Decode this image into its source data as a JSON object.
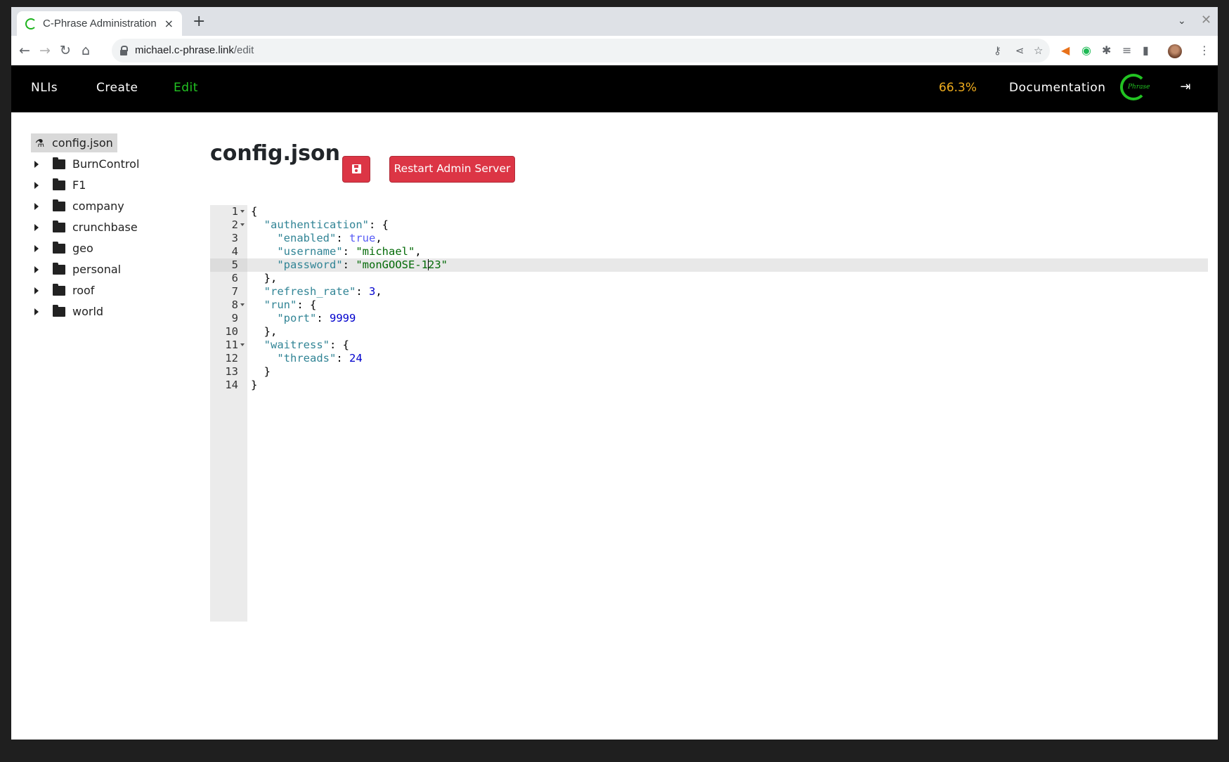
{
  "browser": {
    "tab_title": "C-Phrase Administration",
    "url_host": "michael.c-phrase.link",
    "url_path": "/edit",
    "new_tab_label": "+",
    "tab_close_label": "×"
  },
  "header": {
    "nav": [
      {
        "label": "NLIs"
      },
      {
        "label": "Create"
      },
      {
        "label": "Edit",
        "active": true
      }
    ],
    "usage": "66.3%",
    "documentation": "Documentation",
    "logo_text": "Phrase",
    "accent_color": "#22c322",
    "usage_color": "#f0ad1e"
  },
  "tree": {
    "selected_file": "config.json",
    "folders": [
      "BurnControl",
      "F1",
      "company",
      "crunchbase",
      "geo",
      "personal",
      "roof",
      "world"
    ]
  },
  "main": {
    "title": "config.json",
    "restart_label": "Restart Admin Server",
    "button_color": "#dc3545"
  },
  "editor": {
    "active_line": 5,
    "lines": [
      {
        "n": "1",
        "fold": true
      },
      {
        "n": "2",
        "fold": true
      },
      {
        "n": "3",
        "fold": false
      },
      {
        "n": "4",
        "fold": false
      },
      {
        "n": "5",
        "fold": false
      },
      {
        "n": "6",
        "fold": false
      },
      {
        "n": "7",
        "fold": false
      },
      {
        "n": "8",
        "fold": true
      },
      {
        "n": "9",
        "fold": false
      },
      {
        "n": "10",
        "fold": false
      },
      {
        "n": "11",
        "fold": true
      },
      {
        "n": "12",
        "fold": false
      },
      {
        "n": "13",
        "fold": false
      },
      {
        "n": "14",
        "fold": false
      }
    ],
    "tokens": {
      "l1_open": "{",
      "l2_key": "\"authentication\"",
      "l2_rest": ": {",
      "l3_key": "\"enabled\"",
      "l3_sep": ": ",
      "l3_val": "true",
      "l3_end": ",",
      "l4_key": "\"username\"",
      "l4_sep": ": ",
      "l4_val": "\"michael\"",
      "l4_end": ",",
      "l5_key": "\"password\"",
      "l5_sep": ": ",
      "l5_val_a": "\"monGOOSE-1",
      "l5_val_b": "23\"",
      "l6_close": "},",
      "l7_key": "\"refresh_rate\"",
      "l7_sep": ": ",
      "l7_val": "3",
      "l7_end": ",",
      "l8_key": "\"run\"",
      "l8_rest": ": {",
      "l9_key": "\"port\"",
      "l9_sep": ": ",
      "l9_val": "9999",
      "l10_close": "},",
      "l11_key": "\"waitress\"",
      "l11_rest": ": {",
      "l12_key": "\"threads\"",
      "l12_sep": ": ",
      "l12_val": "24",
      "l13_close": "}",
      "l14_close": "}"
    }
  }
}
